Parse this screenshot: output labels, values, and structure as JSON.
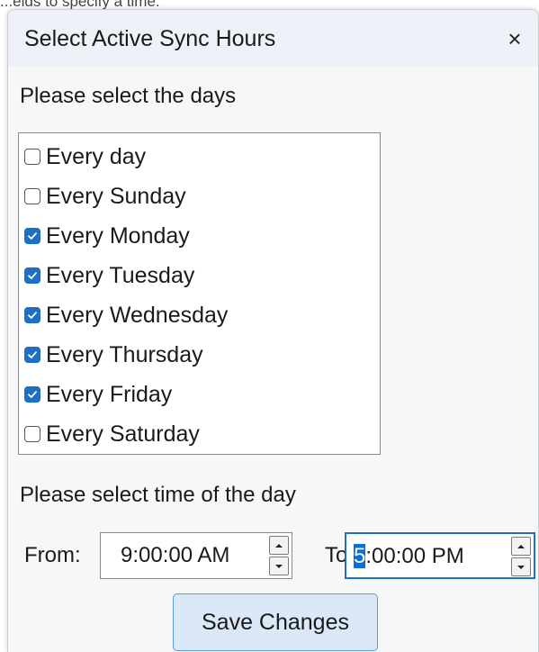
{
  "background_text": "...elds to specify a time.",
  "dialog": {
    "title": "Select Active Sync Hours",
    "close_icon": "×"
  },
  "days_section": {
    "label": "Please select the days",
    "items": [
      {
        "label": "Every day",
        "checked": false
      },
      {
        "label": "Every Sunday",
        "checked": false
      },
      {
        "label": "Every Monday",
        "checked": true
      },
      {
        "label": "Every Tuesday",
        "checked": true
      },
      {
        "label": "Every Wednesday",
        "checked": true
      },
      {
        "label": "Every Thursday",
        "checked": true
      },
      {
        "label": "Every Friday",
        "checked": true
      },
      {
        "label": "Every Saturday",
        "checked": false
      }
    ]
  },
  "time_section": {
    "label": "Please select time of the day",
    "from_label": "From:",
    "from_value": "9:00:00 AM",
    "to_label": "To:",
    "to_value_selected": "5",
    "to_value_rest": ":00:00 PM"
  },
  "save_button": "Save Changes",
  "colors": {
    "accent": "#1f6fc5",
    "selection": "#0a6fd6",
    "title_bar": "#eef2f8",
    "button_bg": "#dbe8f8"
  }
}
